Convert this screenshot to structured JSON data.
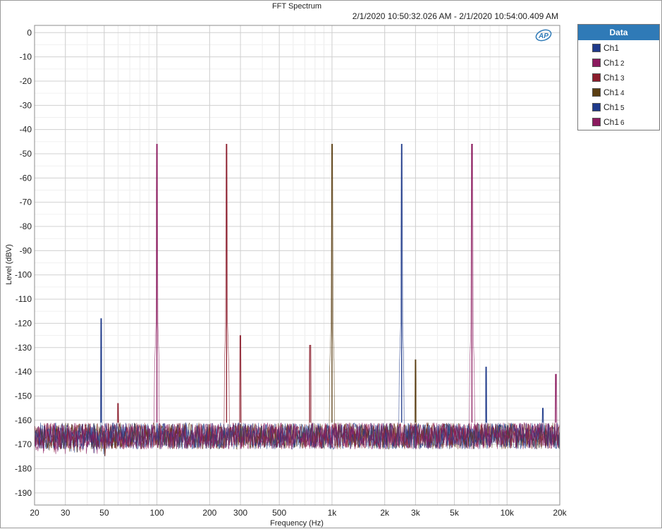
{
  "window": {
    "title": "FFT Spectrum"
  },
  "chart_data": {
    "type": "line",
    "title": "FFT Spectrum",
    "subtitle": "2/1/2020 10:50:32.026 AM - 2/1/2020 10:54:00.409 AM",
    "xlabel": "Frequency (Hz)",
    "ylabel": "Level (dBV)",
    "x_scale": "log",
    "xlim": [
      20,
      20000
    ],
    "ylim": [
      -195,
      3
    ],
    "x_ticks": [
      20,
      30,
      50,
      100,
      200,
      300,
      500,
      1000,
      2000,
      3000,
      5000,
      10000,
      20000
    ],
    "x_tick_labels": [
      "20",
      "30",
      "50",
      "100",
      "200",
      "300",
      "500",
      "1k",
      "2k",
      "3k",
      "5k",
      "10k",
      "20k"
    ],
    "y_ticks": [
      0,
      -10,
      -20,
      -30,
      -40,
      -50,
      -60,
      -70,
      -80,
      -90,
      -100,
      -110,
      -120,
      -130,
      -140,
      -150,
      -160,
      -170,
      -180,
      -190
    ],
    "y_tick_labels": [
      "0",
      "-10",
      "-20",
      "-30",
      "-40",
      "-50",
      "-60",
      "-70",
      "-80",
      "-90",
      "-100",
      "-110",
      "-120",
      "-130",
      "-140",
      "-150",
      "-160",
      "-170",
      "-180",
      "-190"
    ],
    "grid": true,
    "legend_position": "right",
    "noise_floor": {
      "top": -161,
      "bottom": -172
    },
    "series": [
      {
        "name": "Ch1",
        "label_main": "Ch1",
        "label_sub": "",
        "color": "#1f3a8a",
        "peaks": [
          {
            "x": 48,
            "y": -118
          },
          {
            "x": 2500,
            "y": -46
          },
          {
            "x": 7600,
            "y": -138
          }
        ]
      },
      {
        "name": "Ch1 2",
        "label_main": "Ch1",
        "label_sub": "2",
        "color": "#8b1a5e",
        "peaks": [
          {
            "x": 100,
            "y": -46
          },
          {
            "x": 19000,
            "y": -141
          }
        ]
      },
      {
        "name": "Ch1 3",
        "label_main": "Ch1",
        "label_sub": "3",
        "color": "#8b1d2c",
        "peaks": [
          {
            "x": 250,
            "y": -46
          },
          {
            "x": 300,
            "y": -125
          },
          {
            "x": 750,
            "y": -129
          },
          {
            "x": 60,
            "y": -153
          }
        ]
      },
      {
        "name": "Ch1 4",
        "label_main": "Ch1",
        "label_sub": "4",
        "color": "#5a3e12",
        "peaks": [
          {
            "x": 1000,
            "y": -46
          },
          {
            "x": 3000,
            "y": -135
          }
        ]
      },
      {
        "name": "Ch1 5",
        "label_main": "Ch1",
        "label_sub": "5",
        "color": "#1f3a8a",
        "peaks": [
          {
            "x": 16000,
            "y": -155
          }
        ]
      },
      {
        "name": "Ch1 6",
        "label_main": "Ch1",
        "label_sub": "6",
        "color": "#8b1a5e",
        "peaks": [
          {
            "x": 6300,
            "y": -46
          }
        ]
      }
    ]
  },
  "legend": {
    "title": "Data"
  },
  "logo": {
    "text": "AP"
  }
}
